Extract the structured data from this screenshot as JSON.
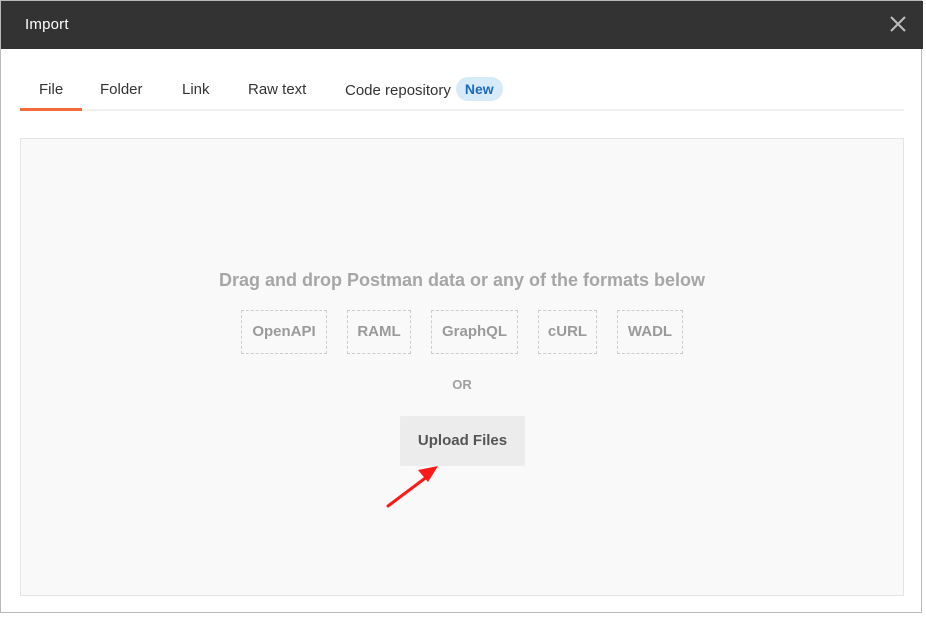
{
  "dialog": {
    "title": "Import"
  },
  "tabs": [
    {
      "label": "File",
      "active": true
    },
    {
      "label": "Folder",
      "active": false
    },
    {
      "label": "Link",
      "active": false
    },
    {
      "label": "Raw text",
      "active": false
    },
    {
      "label": "Code repository",
      "active": false,
      "badge": "New"
    }
  ],
  "dropzone": {
    "instruction": "Drag and drop Postman data or any of the formats below",
    "formats": [
      "OpenAPI",
      "RAML",
      "GraphQL",
      "cURL",
      "WADL"
    ],
    "separator": "OR",
    "upload_label": "Upload Files"
  },
  "colors": {
    "titlebar": "#333333",
    "active_tab_underline": "#f26b3a",
    "badge_bg": "#d7eaf8",
    "badge_text": "#1b6ac2",
    "annotation_arrow": "#ff1a1a"
  },
  "icons": {
    "close": "close-icon"
  }
}
